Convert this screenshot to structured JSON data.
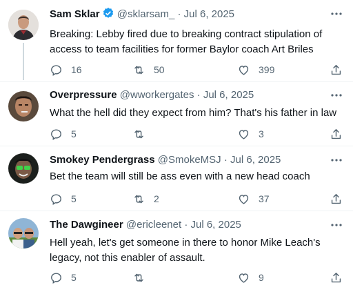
{
  "tweets": [
    {
      "name": "Sam Sklar",
      "verified": true,
      "handle": "@sklarsam_",
      "dot": "·",
      "date": "Jul 6, 2025",
      "text": "Breaking: Lebby fired due to breaking contract stipulation of access to team facilities for former Baylor coach Art Briles",
      "replies": "16",
      "retweets": "50",
      "likes": "399"
    },
    {
      "name": "Overpressure",
      "verified": false,
      "handle": "@wworkergates",
      "dot": "·",
      "date": "Jul 6, 2025",
      "text": "What the hell did they expect from him? That's his father in law",
      "replies": "5",
      "retweets": "",
      "likes": "3"
    },
    {
      "name": "Smokey Pendergrass",
      "verified": false,
      "handle": "@SmokeMSJ",
      "dot": "·",
      "date": "Jul 6, 2025",
      "text": "Bet the team will still be ass even with a new head coach",
      "replies": "5",
      "retweets": "2",
      "likes": "37"
    },
    {
      "name": "The Dawgineer",
      "verified": false,
      "handle": "@ericleenet",
      "dot": "·",
      "date": "Jul 6, 2025",
      "text": "Hell yeah, let's get someone in there to honor Mike Leach's legacy, not this enabler of assault.",
      "replies": "5",
      "retweets": "",
      "likes": "9"
    }
  ],
  "colors": {
    "verified": "#1d9bf0",
    "secondary": "#536471",
    "thread": "#cfd9de"
  },
  "icons": [
    "verified-icon",
    "more-icon",
    "reply-icon",
    "retweet-icon",
    "like-icon",
    "share-icon"
  ]
}
